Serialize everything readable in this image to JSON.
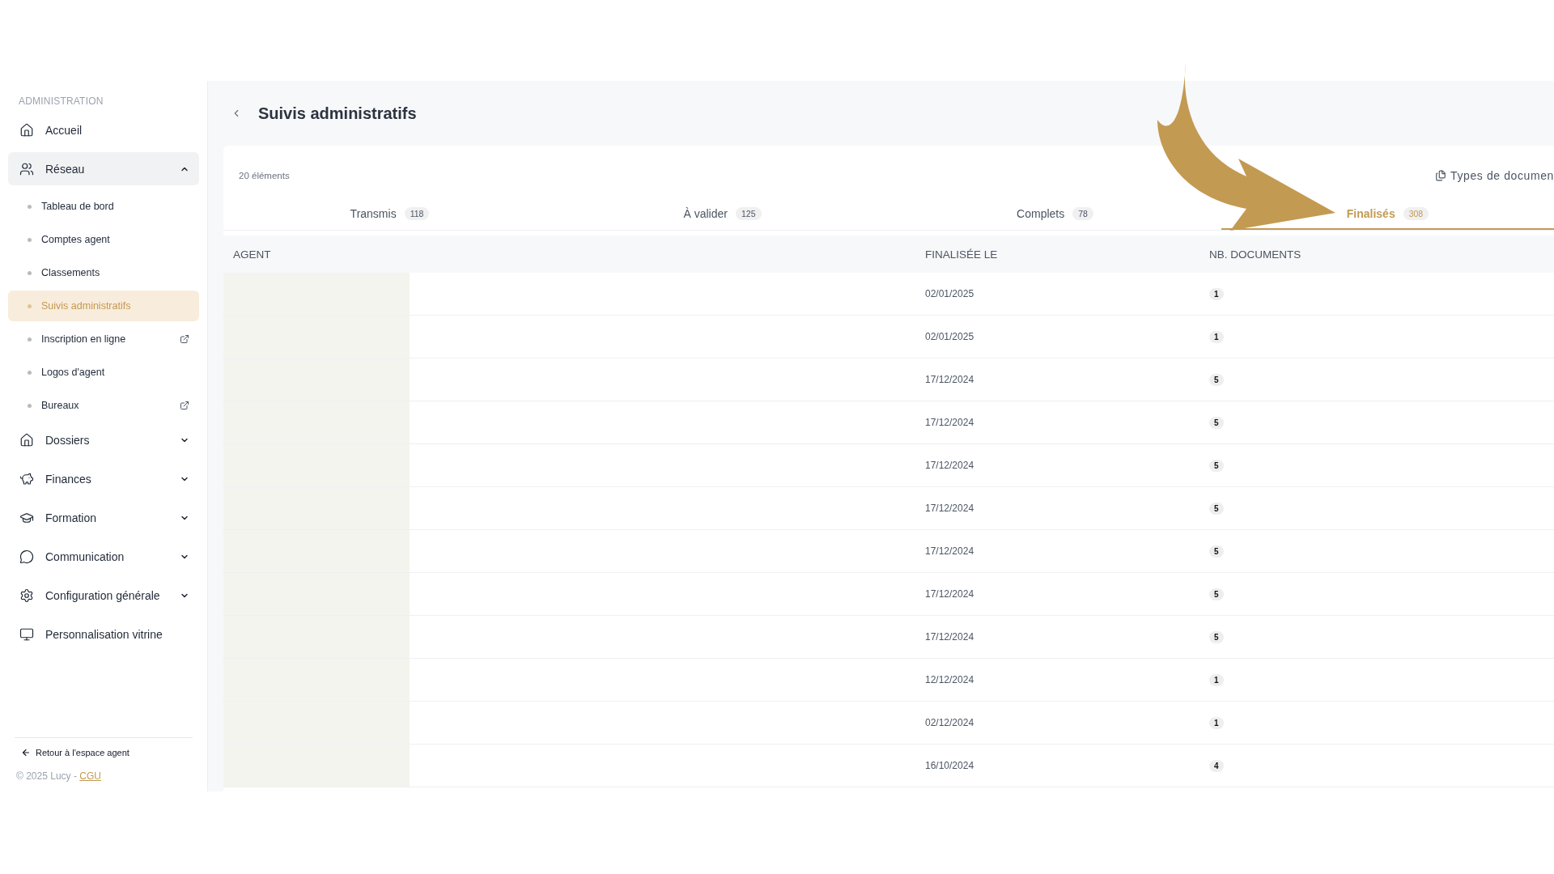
{
  "sidebar": {
    "section_label": "ADMINISTRATION",
    "items": [
      {
        "label": "Accueil",
        "selected": false
      },
      {
        "label": "Réseau",
        "selected": true,
        "expanded": true,
        "children": [
          {
            "label": "Tableau de bord",
            "selected": false,
            "external": false
          },
          {
            "label": "Comptes agent",
            "selected": false,
            "external": false
          },
          {
            "label": "Classements",
            "selected": false,
            "external": false
          },
          {
            "label": "Suivis administratifs",
            "selected": true,
            "external": false
          },
          {
            "label": "Inscription en ligne",
            "selected": false,
            "external": true
          },
          {
            "label": "Logos d'agent",
            "selected": false,
            "external": false
          },
          {
            "label": "Bureaux",
            "selected": false,
            "external": true
          }
        ]
      },
      {
        "label": "Dossiers",
        "selected": false,
        "expanded": false
      },
      {
        "label": "Finances",
        "selected": false,
        "expanded": false
      },
      {
        "label": "Formation",
        "selected": false,
        "expanded": false
      },
      {
        "label": "Communication",
        "selected": false,
        "expanded": false
      },
      {
        "label": "Configuration générale",
        "selected": false,
        "expanded": false
      },
      {
        "label": "Personnalisation vitrine",
        "selected": false
      }
    ],
    "back_link": "Retour à l'espace agent",
    "copyright": "© 2025 Lucy - ",
    "cgu_link": "CGU"
  },
  "page": {
    "title": "Suivis administratifs",
    "count": "20 éléments",
    "action": "Types de documen",
    "tabs": [
      {
        "label": "Transmis",
        "count": "118",
        "selected": false
      },
      {
        "label": "À valider",
        "count": "125",
        "selected": false
      },
      {
        "label": "Complets",
        "count": "78",
        "selected": false
      },
      {
        "label": "Finalisés",
        "count": "308",
        "selected": true
      }
    ],
    "table": {
      "columns": [
        "AGENT",
        "FINALISÉE LE",
        "NB. DOCUMENTS"
      ],
      "rows": [
        {
          "date": "02/01/2025",
          "documents": "1"
        },
        {
          "date": "02/01/2025",
          "documents": "1"
        },
        {
          "date": "17/12/2024",
          "documents": "5"
        },
        {
          "date": "17/12/2024",
          "documents": "5"
        },
        {
          "date": "17/12/2024",
          "documents": "5"
        },
        {
          "date": "17/12/2024",
          "documents": "5"
        },
        {
          "date": "17/12/2024",
          "documents": "5"
        },
        {
          "date": "17/12/2024",
          "documents": "5"
        },
        {
          "date": "17/12/2024",
          "documents": "5"
        },
        {
          "date": "12/12/2024",
          "documents": "1"
        },
        {
          "date": "02/12/2024",
          "documents": "1"
        },
        {
          "date": "16/10/2024",
          "documents": "4"
        }
      ]
    }
  }
}
